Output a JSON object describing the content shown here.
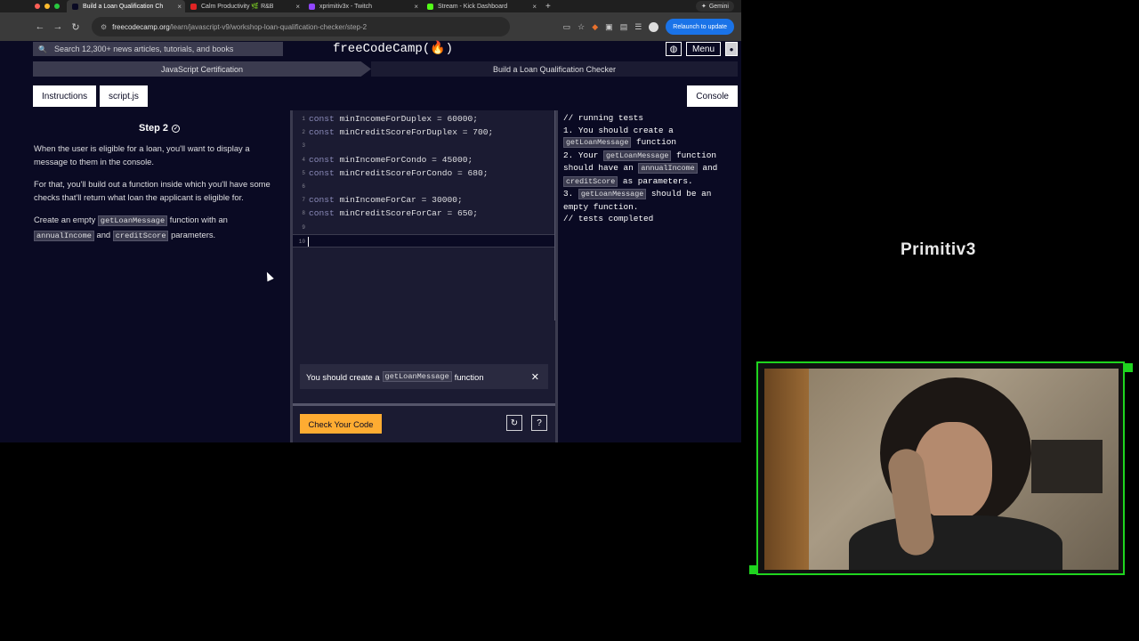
{
  "browser": {
    "tabs": [
      {
        "title": "Build a Loan Qualification Ch",
        "color": "#0a0a23",
        "active": true
      },
      {
        "title": "Calm Productivity 🌿 R&B",
        "color": "#e02424",
        "active": false
      },
      {
        "title": "xprimitiv3x - Twitch",
        "color": "#9146ff",
        "active": false
      },
      {
        "title": "Stream - Kick Dashboard",
        "color": "#53fc18",
        "active": false
      }
    ],
    "gemini_label": "Gemini",
    "url_host": "freecodecamp.org",
    "url_path": "/learn/javascript-v9/workshop-loan-qualification-checker/step-2",
    "relaunch_label": "Relaunch to update"
  },
  "fcc": {
    "search_placeholder": "Search 12,300+ news articles, tutorials, and books",
    "brand": "freeCodeCamp(🔥)",
    "menu_label": "Menu",
    "breadcrumb_cert": "JavaScript Certification",
    "breadcrumb_project": "Build a Loan Qualification Checker",
    "btn_instructions": "Instructions",
    "btn_script": "script.js",
    "btn_console": "Console"
  },
  "instructions": {
    "step_title": "Step 2",
    "p1": "When the user is eligible for a loan, you'll want to display a message to them in the console.",
    "p2": "For that, you'll build out a function inside which you'll have some checks that'll return what loan the applicant is eligible for.",
    "p3_pre": "Create an empty ",
    "p3_code1": "getLoanMessage",
    "p3_mid1": " function with an ",
    "p3_code2": "annualIncome",
    "p3_mid2": " and ",
    "p3_code3": "creditScore",
    "p3_post": " parameters."
  },
  "editor": {
    "lines": [
      {
        "n": "1",
        "kw": "const",
        "rest": " minIncomeForDuplex = 60000;"
      },
      {
        "n": "2",
        "kw": "const",
        "rest": " minCreditScoreForDuplex = 700;"
      },
      {
        "n": "3",
        "kw": "",
        "rest": ""
      },
      {
        "n": "4",
        "kw": "const",
        "rest": " minIncomeForCondo = 45000;"
      },
      {
        "n": "5",
        "kw": "const",
        "rest": " minCreditScoreForCondo = 680;"
      },
      {
        "n": "6",
        "kw": "",
        "rest": ""
      },
      {
        "n": "7",
        "kw": "const",
        "rest": " minIncomeForCar = 30000;"
      },
      {
        "n": "8",
        "kw": "const",
        "rest": " minCreditScoreForCar = 650;"
      },
      {
        "n": "9",
        "kw": "",
        "rest": ""
      },
      {
        "n": "10",
        "kw": "",
        "rest": ""
      }
    ],
    "hint_pre": "You should create a",
    "hint_code": "getLoanMessage",
    "hint_post": "function",
    "check_label": "Check Your Code"
  },
  "console": {
    "l1": "// running tests",
    "l2_pre": "1. You should create a ",
    "l2_code": "getLoanMessage",
    "l2_post": " function",
    "l3_pre": "2. Your ",
    "l3_code": "getLoanMessage",
    "l3_mid": " function should have an ",
    "l3_code2": "annualIncome",
    "l3_mid2": " and ",
    "l3_code3": "creditScore",
    "l3_post": " as parameters.",
    "l4_pre": "3. ",
    "l4_code": "getLoanMessage",
    "l4_post": " should be an empty function.",
    "l5": "// tests completed"
  },
  "stream": {
    "overlay_name": "Primitiv3"
  }
}
